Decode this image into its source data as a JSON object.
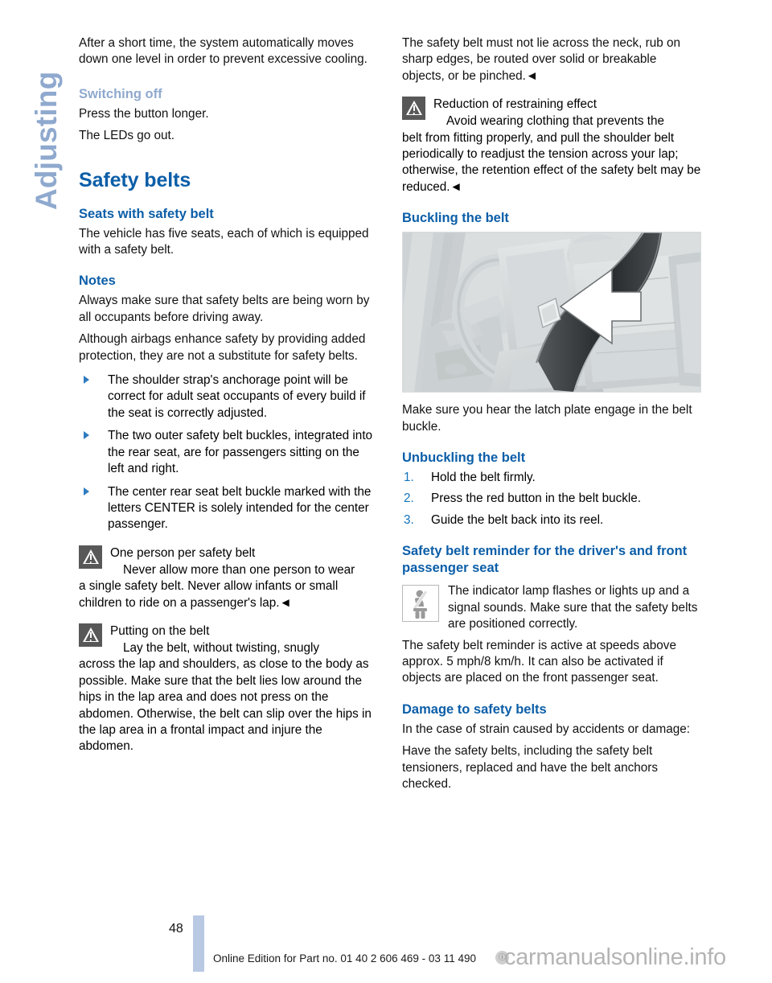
{
  "chapter_tab": {
    "label": "Adjusting"
  },
  "left_column": {
    "intro_paragraph": "After a short time, the system automatically moves down one level in order to prevent excessive cooling.",
    "switching_off_heading": "Switching off",
    "switching_off_line1": "Press the button longer.",
    "switching_off_line2": "The LEDs go out.",
    "section_title": "Safety belts",
    "seats_heading": "Seats with safety belt",
    "seats_paragraph": "The vehicle has five seats, each of which is equipped with a safety belt.",
    "notes_heading": "Notes",
    "notes_paragraph_1": "Always make sure that safety belts are being worn by all occupants before driving away.",
    "notes_paragraph_2": "Although airbags enhance safety by providing added protection, they are not a substitute for safety belts.",
    "bullets": [
      "The shoulder strap's anchorage point will be correct for adult seat occupants of every build if the seat is correctly adjusted.",
      "The two outer safety belt buckles, integrated into the rear seat, are for passengers sitting on the left and right.",
      "The center rear seat belt buckle marked with the letters CENTER is solely intended for the center passenger."
    ],
    "warning_one_person": {
      "title": "One person per safety belt",
      "body_first": "Never allow more than one person to wear",
      "body_rest": "a single safety belt. Never allow infants or small children to ride on a passenger's lap.◄"
    },
    "warning_putting_on": {
      "title": "Putting on the belt",
      "body_first": "Lay the belt, without twisting, snugly",
      "body_rest": "across the lap and shoulders, as close to the body as possible. Make sure that the belt lies low around the hips in the lap area and does not press on the abdomen. Otherwise, the belt can slip over the hips in the lap area in a frontal impact and injure the abdomen."
    }
  },
  "right_column": {
    "top_paragraph": "The safety belt must not lie across the neck, rub on sharp edges, be routed over solid or breakable objects, or be pinched.◄",
    "warning_reduction": {
      "title": "Reduction of restraining effect",
      "body_first": "Avoid wearing clothing that prevents the",
      "body_rest": "belt from fitting properly, and pull the shoulder belt periodically to readjust the tension across your lap; otherwise, the retention effect of the safety belt may be reduced.◄"
    },
    "buckling_heading": "Buckling the belt",
    "figure_caption": "Make sure you hear the latch plate engage in the belt buckle.",
    "unbuckling_heading": "Unbuckling the belt",
    "unbuckling_steps": [
      {
        "number": "1.",
        "text": "Hold the belt firmly."
      },
      {
        "number": "2.",
        "text": "Press the red button in the belt buckle."
      },
      {
        "number": "3.",
        "text": "Guide the belt back into its reel."
      }
    ],
    "reminder_heading": "Safety belt reminder for the driver's and front passenger seat",
    "reminder_body_indented": "The indicator lamp flashes or lights up and a signal sounds. Make sure that the safety belts are positioned correctly.",
    "reminder_body_rest": "The safety belt reminder is active at speeds above approx. 5 mph/8 km/h. It can also be activated if objects are placed on the front passenger seat.",
    "damage_heading": "Damage to safety belts",
    "damage_paragraph_1": "In the case of strain caused by accidents or damage:",
    "damage_paragraph_2": "Have the safety belts, including the safety belt tensioners, replaced and have the belt anchors checked."
  },
  "footer": {
    "page_number": "48",
    "edition_text": "Online Edition for Part no. 01 40 2 606 469 - 03 11 490",
    "watermark_text": "carmanualsonline.info",
    "watermark_badge": "ⓘ"
  },
  "colors": {
    "heading_blue": "#0B5EA8",
    "muted_blue": "#8FA9CE",
    "marker_blue": "#1273BE",
    "warning_icon_gray": "#585858",
    "footer_bar_blue": "#B9C9E4"
  }
}
